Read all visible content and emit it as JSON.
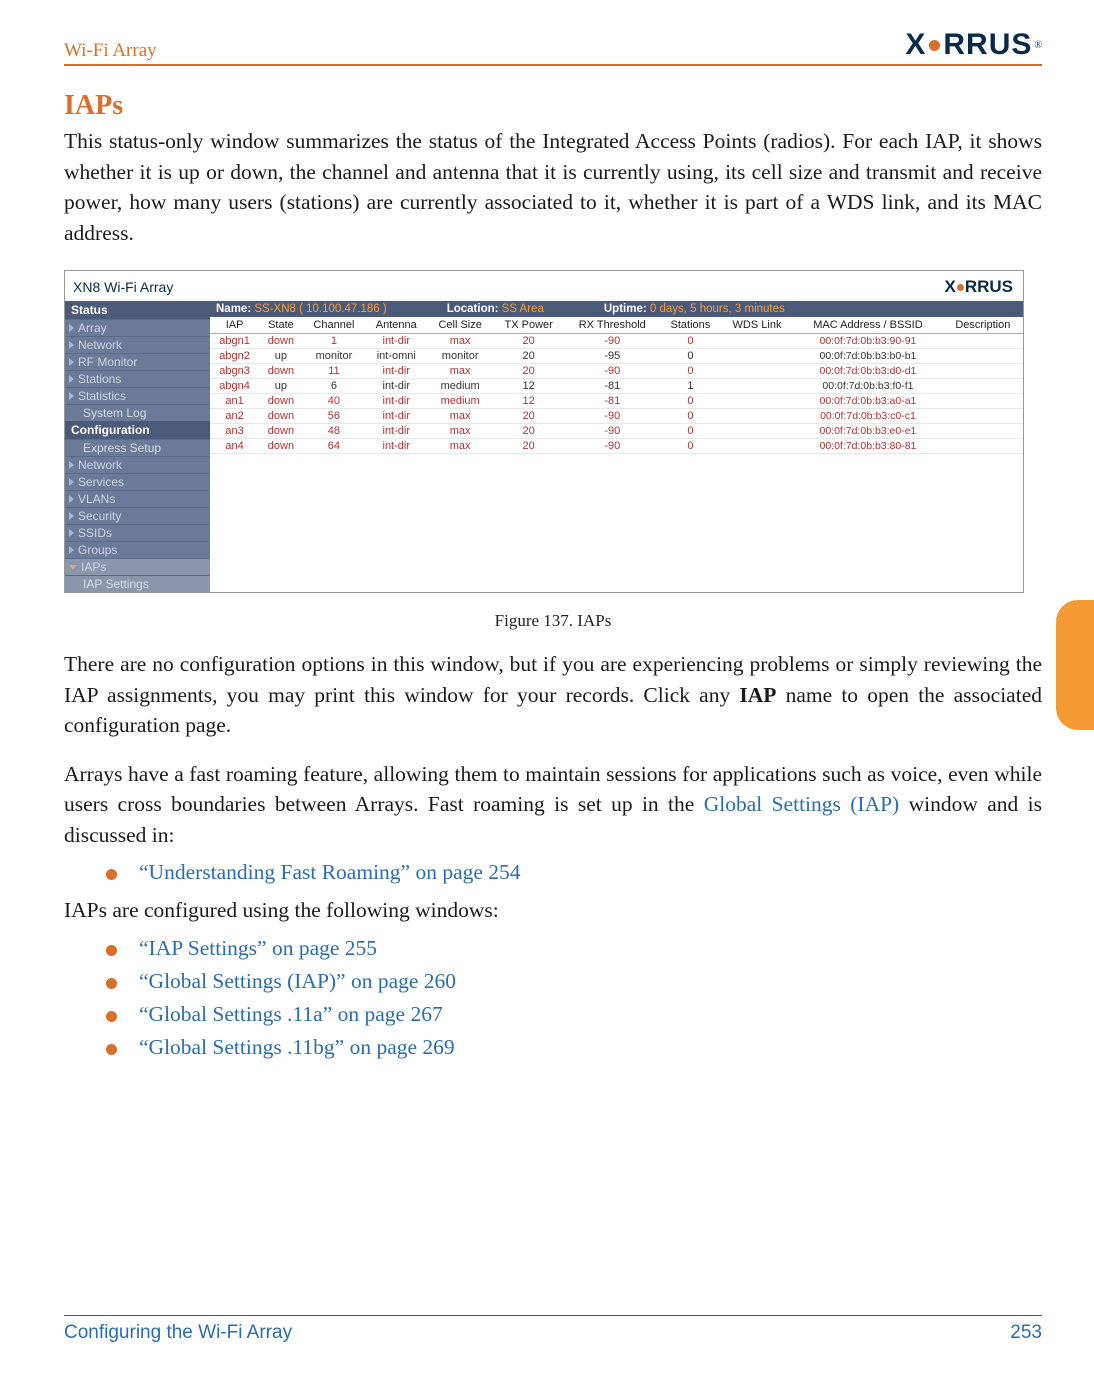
{
  "header": {
    "title": "Wi-Fi Array",
    "logo_text": "XIRRUS"
  },
  "section": {
    "title": "IAPs",
    "intro": "This status-only window summarizes the status of the Integrated Access Points (radios). For each IAP, it shows whether it is up or down, the channel and antenna that it is currently using, its cell size and transmit and receive power, how many users (stations) are currently associated to it, whether it is part of a WDS link, and its MAC address."
  },
  "figure": {
    "caption": "Figure 137. IAPs",
    "brand_title": "XN8 Wi-Fi Array",
    "nav_headers": [
      "Status",
      "Configuration"
    ],
    "nav_status": [
      "Array",
      "Network",
      "RF Monitor",
      "Stations",
      "Statistics",
      "System Log"
    ],
    "nav_config": [
      "Express Setup",
      "Network",
      "Services",
      "VLANs",
      "Security",
      "SSIDs",
      "Groups",
      "IAPs",
      "IAP Settings"
    ],
    "infobar": {
      "name_label": "Name:",
      "name_value": "SS-XN8   ( 10.100.47.186 )",
      "location_label": "Location:",
      "location_value": "SS Area",
      "uptime_label": "Uptime:",
      "uptime_value": "0 days, 5 hours, 3 minutes"
    },
    "columns": [
      "IAP",
      "State",
      "Channel",
      "Antenna",
      "Cell Size",
      "TX Power",
      "RX Threshold",
      "Stations",
      "WDS Link",
      "MAC Address / BSSID",
      "Description"
    ],
    "rows": [
      {
        "iap": "abgn1",
        "state": "down",
        "channel": "1",
        "antenna": "int-dir",
        "cell": "max",
        "tx": "20",
        "rx": "-90",
        "stations": "0",
        "wds": "",
        "mac": "00:0f:7d:0b:b3:90-91",
        "red": true
      },
      {
        "iap": "abgn2",
        "state": "up",
        "channel": "monitor",
        "antenna": "int-omni",
        "cell": "monitor",
        "tx": "20",
        "rx": "-95",
        "stations": "0",
        "wds": "",
        "mac": "00:0f:7d:0b:b3:b0-b1",
        "red": false
      },
      {
        "iap": "abgn3",
        "state": "down",
        "channel": "11",
        "antenna": "int-dir",
        "cell": "max",
        "tx": "20",
        "rx": "-90",
        "stations": "0",
        "wds": "",
        "mac": "00:0f:7d:0b:b3:d0-d1",
        "red": true
      },
      {
        "iap": "abgn4",
        "state": "up",
        "channel": "6",
        "antenna": "int-dir",
        "cell": "medium",
        "tx": "12",
        "rx": "-81",
        "stations": "1",
        "wds": "",
        "mac": "00:0f:7d:0b:b3:f0-f1",
        "red": false
      },
      {
        "iap": "an1",
        "state": "down",
        "channel": "40",
        "antenna": "int-dir",
        "cell": "medium",
        "tx": "12",
        "rx": "-81",
        "stations": "0",
        "wds": "",
        "mac": "00:0f:7d:0b:b3:a0-a1",
        "red": true
      },
      {
        "iap": "an2",
        "state": "down",
        "channel": "56",
        "antenna": "int-dir",
        "cell": "max",
        "tx": "20",
        "rx": "-90",
        "stations": "0",
        "wds": "",
        "mac": "00:0f:7d:0b:b3:c0-c1",
        "red": true
      },
      {
        "iap": "an3",
        "state": "down",
        "channel": "48",
        "antenna": "int-dir",
        "cell": "max",
        "tx": "20",
        "rx": "-90",
        "stations": "0",
        "wds": "",
        "mac": "00:0f:7d:0b:b3:e0-e1",
        "red": true
      },
      {
        "iap": "an4",
        "state": "down",
        "channel": "64",
        "antenna": "int-dir",
        "cell": "max",
        "tx": "20",
        "rx": "-90",
        "stations": "0",
        "wds": "",
        "mac": "00:0f:7d:0b:b3:80-81",
        "red": true
      }
    ]
  },
  "para2_a": "There are no configuration options in this window, but if you are experiencing problems or simply reviewing the IAP assignments, you may print this window for your records. Click any ",
  "para2_bold": "IAP",
  "para2_b": " name to open the associated configuration page.",
  "para3_a": "Arrays have a fast roaming feature, allowing them to maintain sessions for applications such as voice, even while users cross boundaries between Arrays. Fast roaming is set up in the ",
  "para3_link": "Global Settings (IAP)",
  "para3_b": " window and is discussed in:",
  "bullets1": [
    "“Understanding Fast Roaming” on page 254"
  ],
  "para4": "IAPs are configured using the following windows:",
  "bullets2": [
    "“IAP Settings” on page 255",
    "“Global Settings (IAP)” on page 260",
    "“Global Settings .11a” on page 267",
    "“Global Settings .11bg” on page 269"
  ],
  "footer": {
    "left": "Configuring the Wi-Fi Array",
    "right": "253"
  }
}
